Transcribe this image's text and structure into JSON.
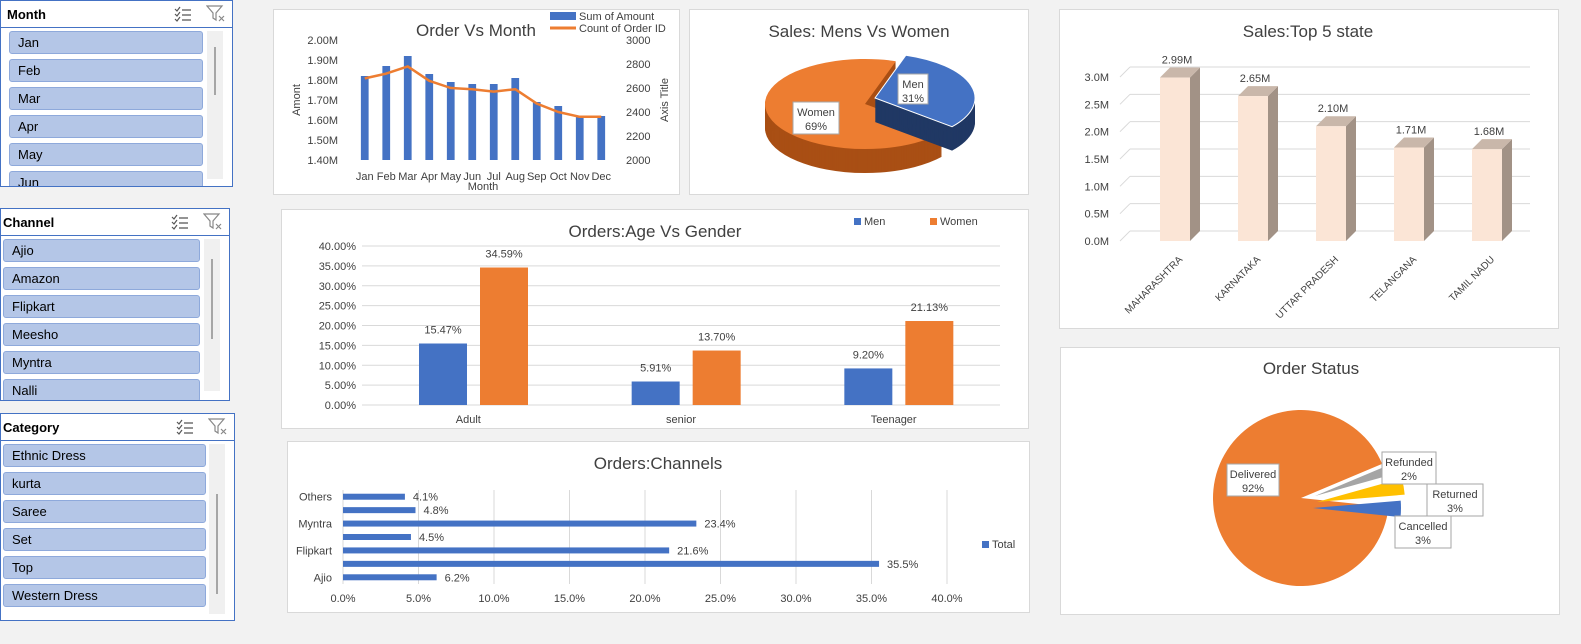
{
  "slicers": [
    {
      "title": "Month",
      "items": [
        "Jan",
        "Feb",
        "Mar",
        "Apr",
        "May",
        "Jun"
      ]
    },
    {
      "title": "Channel",
      "items": [
        "Ajio",
        "Amazon",
        "Flipkart",
        "Meesho",
        "Myntra",
        "Nalli"
      ]
    },
    {
      "title": "Category",
      "items": [
        "Ethnic Dress",
        "kurta",
        "Saree",
        "Set",
        "Top",
        "Western Dress"
      ]
    }
  ],
  "colors": {
    "blue": "#4472c4",
    "orange": "#ed7d31",
    "peach": "#fbe5d6",
    "grey": "#a5a5a5",
    "yellow": "#ffc000"
  },
  "chart_data": [
    {
      "type": "bar",
      "title": "Order Vs Month",
      "xlabel": "Month",
      "ylabel": "Amont",
      "y2label": "Axis Title",
      "categories": [
        "Jan",
        "Feb",
        "Mar",
        "Apr",
        "May",
        "Jun",
        "Jul",
        "Aug",
        "Sep",
        "Oct",
        "Nov",
        "Dec"
      ],
      "ylim": [
        1400000,
        2000000
      ],
      "y2lim": [
        2000,
        3000
      ],
      "yticks": [
        "1.40M",
        "1.50M",
        "1.60M",
        "1.70M",
        "1.80M",
        "1.90M",
        "2.00M"
      ],
      "y2ticks": [
        "2000",
        "2200",
        "2400",
        "2600",
        "2800",
        "3000"
      ],
      "series": [
        {
          "name": "Sum of Amount",
          "values": [
            1820000,
            1870000,
            1920000,
            1830000,
            1790000,
            1780000,
            1780000,
            1810000,
            1690000,
            1670000,
            1620000,
            1620000
          ]
        },
        {
          "name": "Count of Order ID",
          "type": "line",
          "axis": "secondary",
          "values": [
            2680,
            2720,
            2780,
            2660,
            2600,
            2590,
            2570,
            2590,
            2470,
            2400,
            2360,
            2360
          ]
        }
      ]
    },
    {
      "type": "pie",
      "title": "Sales: Mens Vs Women",
      "slices": [
        {
          "label": "Men",
          "value": 31,
          "display": "31%"
        },
        {
          "label": "Women",
          "value": 69,
          "display": "69%"
        }
      ]
    },
    {
      "type": "bar",
      "title": "Sales:Top 5 state",
      "categories": [
        "MAHARASHTRA",
        "KARNATAKA",
        "UTTAR PRADESH",
        "TELANGANA",
        "TAMIL NADU"
      ],
      "values": [
        2.99,
        2.65,
        2.1,
        1.71,
        1.68
      ],
      "labels": [
        "2.99M",
        "2.65M",
        "2.10M",
        "1.71M",
        "1.68M"
      ],
      "ylim": [
        0,
        3.0
      ],
      "yticks": [
        "0.0M",
        "0.5M",
        "1.0M",
        "1.5M",
        "2.0M",
        "2.5M",
        "3.0M"
      ]
    },
    {
      "type": "bar",
      "title": "Orders:Age Vs Gender",
      "categories": [
        "Adult",
        "senior",
        "Teenager"
      ],
      "ylim": [
        0,
        40
      ],
      "yticks": [
        "0.00%",
        "5.00%",
        "10.00%",
        "15.00%",
        "20.00%",
        "25.00%",
        "30.00%",
        "35.00%",
        "40.00%"
      ],
      "series": [
        {
          "name": "Men",
          "values": [
            15.47,
            5.91,
            9.2
          ],
          "labels": [
            "15.47%",
            "5.91%",
            "9.20%"
          ]
        },
        {
          "name": "Women",
          "values": [
            34.59,
            13.7,
            21.13
          ],
          "labels": [
            "34.59%",
            "13.70%",
            "21.13%"
          ]
        }
      ]
    },
    {
      "type": "bar",
      "orientation": "horizontal",
      "title": "Orders:Channels",
      "legend": "Total",
      "categories": [
        "Ajio",
        "",
        "Flipkart",
        "",
        "Myntra",
        "",
        "Others"
      ],
      "values": [
        6.2,
        35.5,
        21.6,
        4.5,
        23.4,
        4.8,
        4.1
      ],
      "labels": [
        "6.2%",
        "35.5%",
        "21.6%",
        "4.5%",
        "23.4%",
        "4.8%",
        "4.1%"
      ],
      "xlim": [
        0,
        40
      ],
      "xticks": [
        "0.0%",
        "5.0%",
        "10.0%",
        "15.0%",
        "20.0%",
        "25.0%",
        "30.0%",
        "35.0%",
        "40.0%"
      ]
    },
    {
      "type": "pie",
      "title": "Order Status",
      "slices": [
        {
          "label": "Delivered",
          "value": 92,
          "display": "92%"
        },
        {
          "label": "Refunded",
          "value": 2,
          "display": "2%"
        },
        {
          "label": "Returned",
          "value": 3,
          "display": "3%"
        },
        {
          "label": "Cancelled",
          "value": 3,
          "display": "3%"
        }
      ]
    }
  ]
}
